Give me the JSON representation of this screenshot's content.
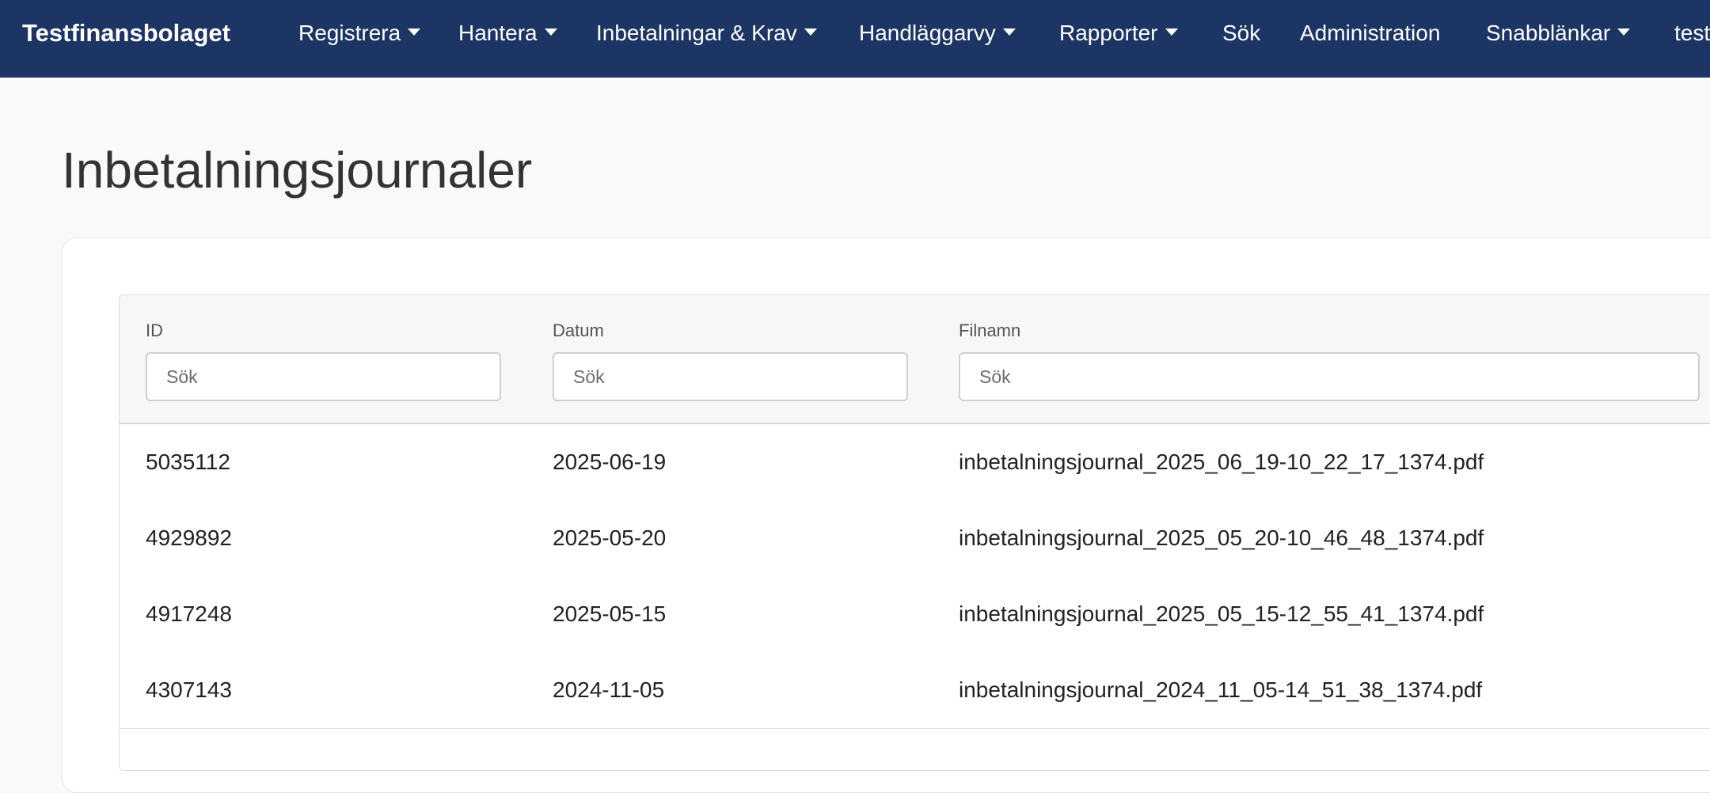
{
  "navbar": {
    "brand": "Testfinansbolaget",
    "items": [
      {
        "label": "Registrera",
        "dropdown": true
      },
      {
        "label": "Hantera",
        "dropdown": true
      },
      {
        "label": "Inbetalningar & Krav",
        "dropdown": true
      },
      {
        "label": "Handläggarvy",
        "dropdown": true
      },
      {
        "label": "Rapporter",
        "dropdown": true
      },
      {
        "label": "Sök",
        "dropdown": false
      },
      {
        "label": "Administration",
        "dropdown": false
      },
      {
        "label": "Snabblänkar",
        "dropdown": true
      },
      {
        "label": "test",
        "dropdown": false
      }
    ],
    "background_color": "#1d3565"
  },
  "page": {
    "title": "Inbetalningsjournaler"
  },
  "table": {
    "columns": [
      {
        "label": "ID",
        "search_placeholder": "Sök"
      },
      {
        "label": "Datum",
        "search_placeholder": "Sök"
      },
      {
        "label": "Filnamn",
        "search_placeholder": "Sök"
      }
    ],
    "rows": [
      {
        "id": "5035112",
        "date": "2025-06-19",
        "filename": "inbetalningsjournal_2025_06_19-10_22_17_1374.pdf"
      },
      {
        "id": "4929892",
        "date": "2025-05-20",
        "filename": "inbetalningsjournal_2025_05_20-10_46_48_1374.pdf"
      },
      {
        "id": "4917248",
        "date": "2025-05-15",
        "filename": "inbetalningsjournal_2025_05_15-12_55_41_1374.pdf"
      },
      {
        "id": "4307143",
        "date": "2024-11-05",
        "filename": "inbetalningsjournal_2024_11_05-14_51_38_1374.pdf"
      }
    ]
  }
}
